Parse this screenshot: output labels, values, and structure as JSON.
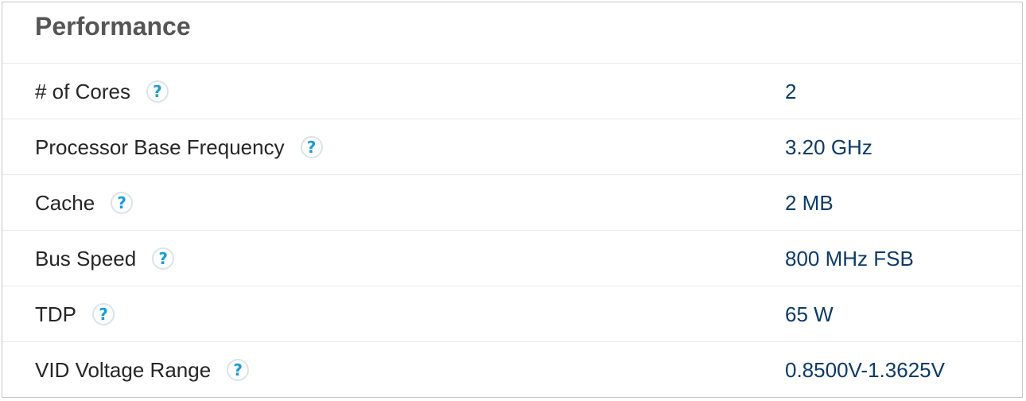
{
  "section": {
    "title": "Performance"
  },
  "specs": [
    {
      "label": "# of Cores",
      "value": "2",
      "help_icon": "question-mark",
      "help_symbol": "?"
    },
    {
      "label": "Processor Base Frequency",
      "value": "3.20 GHz",
      "help_icon": "question-mark",
      "help_symbol": "?"
    },
    {
      "label": "Cache",
      "value": "2 MB",
      "help_icon": "question-mark",
      "help_symbol": "?"
    },
    {
      "label": "Bus Speed",
      "value": "800 MHz FSB",
      "help_icon": "question-mark",
      "help_symbol": "?"
    },
    {
      "label": "TDP",
      "value": "65 W",
      "help_icon": "question-mark",
      "help_symbol": "?"
    },
    {
      "label": "VID Voltage Range",
      "value": "0.8500V-1.3625V",
      "help_icon": "question-mark",
      "help_symbol": "?"
    }
  ],
  "colors": {
    "title": "#555555",
    "label": "#262626",
    "value": "#0d3a66",
    "help_icon": "#1a9bd7",
    "divider": "#ebebeb",
    "border": "#c8c8c8"
  }
}
